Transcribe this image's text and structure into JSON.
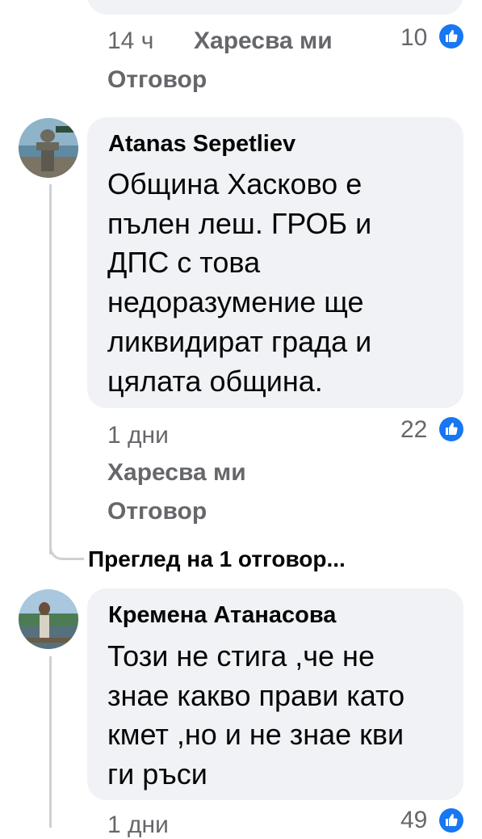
{
  "top_comment": {
    "time": "14 ч",
    "like_label": "Харесва ми",
    "reply_label": "Отговор",
    "like_count": "10"
  },
  "comment1": {
    "author": "Atanas Sepetliev",
    "lines": [
      "Община Хасково е",
      "пълен леш. ГРОБ и",
      "ДПС с това",
      "недоразумение ще",
      "ликвидират града и",
      "цялата община."
    ],
    "time": "1 дни",
    "like_label": "Харесва ми",
    "reply_label": "Отговор",
    "like_count": "22",
    "view_replies": "Преглед на 1 отговор..."
  },
  "comment2": {
    "author": "Кремена Атанасова",
    "lines": [
      "Този не стига ,че не",
      "знае какво прави като",
      "кмет ,но и не знае кви",
      "ги ръси"
    ],
    "time": "1 дни",
    "like_count": "49"
  },
  "colors": {
    "bubble": "#f0f2f5",
    "meta_text": "#65676b",
    "like_blue": "#1877f2",
    "thread_line": "#ced0d4"
  }
}
